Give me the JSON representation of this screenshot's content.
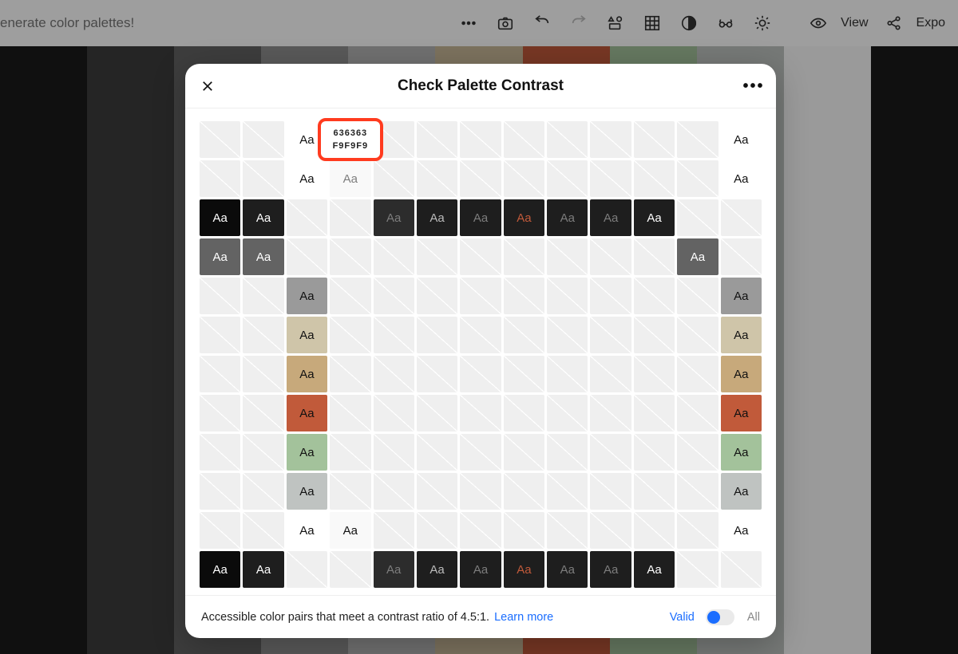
{
  "topbar": {
    "left_text": "enerate color palettes!",
    "view_label": "View",
    "export_label": "Expo"
  },
  "palette_colors": [
    "#1a1a1a",
    "#3c3c3c",
    "#636363",
    "#909090",
    "#b5b5b5",
    "#c8b998",
    "#c15a3a",
    "#a3c29b",
    "#bfc3c1",
    "#f9f9f9",
    "#1a1a1a"
  ],
  "modal": {
    "title": "Check Palette Contrast",
    "footer_text": "Accessible color pairs that meet a contrast ratio of 4.5:1.",
    "learn_more": "Learn more",
    "valid_label": "Valid",
    "all_label": "All"
  },
  "tooltip": {
    "fg": "636363",
    "bg": "F9F9F9"
  },
  "sample": "Aa",
  "grid": {
    "colors": {
      "c0": "#0b0b0b",
      "c1": "#1e1e1e",
      "c2": "#ffffff",
      "c3": "#f9f9f9",
      "c4": "#2c2c2c",
      "c5": "#636363",
      "c6": "#9a9a9a",
      "c7": "#cfc5a9",
      "c8": "#c7a97b",
      "c9": "#c15a3a",
      "c10": "#a3c29b",
      "c11": "#bfc3c1",
      "c12": "#ffffff"
    },
    "text_colors": {
      "white": "#ffffff",
      "black": "#111111",
      "grey": "#7d7d7d",
      "ltgrey": "#bcbcbc",
      "orange": "#c15a3a"
    },
    "matrix": [
      [
        null,
        null,
        [
          "c2",
          "black"
        ],
        [
          "c3",
          "grey"
        ],
        null,
        null,
        null,
        null,
        null,
        null,
        null,
        null,
        [
          "c12",
          "black"
        ]
      ],
      [
        null,
        null,
        [
          "c2",
          "black"
        ],
        [
          "c3",
          "grey"
        ],
        null,
        null,
        null,
        null,
        null,
        null,
        null,
        null,
        [
          "c12",
          "black"
        ]
      ],
      [
        [
          "c0",
          "white"
        ],
        [
          "c1",
          "white"
        ],
        null,
        null,
        [
          "c4",
          "grey"
        ],
        [
          "c1",
          "ltgrey"
        ],
        [
          "c1",
          "grey"
        ],
        [
          "c1",
          "orange"
        ],
        [
          "c1",
          "grey"
        ],
        [
          "c1",
          "grey"
        ],
        [
          "c1",
          "white"
        ],
        null,
        null
      ],
      [
        [
          "c5",
          "white"
        ],
        [
          "c5",
          "white"
        ],
        null,
        null,
        null,
        null,
        null,
        null,
        null,
        null,
        null,
        [
          "c5",
          "white"
        ],
        null
      ],
      [
        null,
        null,
        [
          "c6",
          "black"
        ],
        null,
        null,
        null,
        null,
        null,
        null,
        null,
        null,
        null,
        [
          "c6",
          "black"
        ]
      ],
      [
        null,
        null,
        [
          "c7",
          "black"
        ],
        null,
        null,
        null,
        null,
        null,
        null,
        null,
        null,
        null,
        [
          "c7",
          "black"
        ]
      ],
      [
        null,
        null,
        [
          "c8",
          "black"
        ],
        null,
        null,
        null,
        null,
        null,
        null,
        null,
        null,
        null,
        [
          "c8",
          "black"
        ]
      ],
      [
        null,
        null,
        [
          "c9",
          "black"
        ],
        null,
        null,
        null,
        null,
        null,
        null,
        null,
        null,
        null,
        [
          "c9",
          "black"
        ]
      ],
      [
        null,
        null,
        [
          "c10",
          "black"
        ],
        null,
        null,
        null,
        null,
        null,
        null,
        null,
        null,
        null,
        [
          "c10",
          "black"
        ]
      ],
      [
        null,
        null,
        [
          "c11",
          "black"
        ],
        null,
        null,
        null,
        null,
        null,
        null,
        null,
        null,
        null,
        [
          "c11",
          "black"
        ]
      ],
      [
        null,
        null,
        [
          "c2",
          "black"
        ],
        [
          "c3",
          "black"
        ],
        null,
        null,
        null,
        null,
        null,
        null,
        null,
        null,
        [
          "c12",
          "black"
        ]
      ],
      [
        [
          "c0",
          "white"
        ],
        [
          "c1",
          "white"
        ],
        null,
        null,
        [
          "c4",
          "grey"
        ],
        [
          "c1",
          "ltgrey"
        ],
        [
          "c1",
          "grey"
        ],
        [
          "c1",
          "orange"
        ],
        [
          "c1",
          "grey"
        ],
        [
          "c1",
          "grey"
        ],
        [
          "c1",
          "white"
        ],
        null,
        null
      ]
    ]
  }
}
